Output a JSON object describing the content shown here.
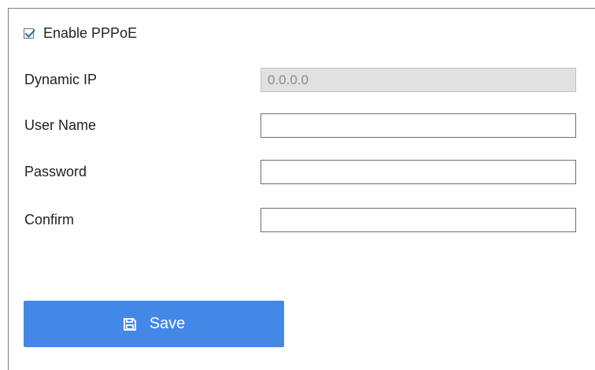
{
  "pppoe": {
    "enable_label": "Enable PPPoE",
    "enable_checked": true
  },
  "fields": {
    "dynamic_ip": {
      "label": "Dynamic IP",
      "value": "0.0.0.0"
    },
    "user_name": {
      "label": "User Name",
      "value": ""
    },
    "password": {
      "label": "Password",
      "value": ""
    },
    "confirm": {
      "label": "Confirm",
      "value": ""
    }
  },
  "actions": {
    "save_label": "Save",
    "save_icon": "save-icon"
  },
  "colors": {
    "accent": "#4388e6",
    "checkbox_check": "#1f78d1",
    "disabled_field": "#e1e1e1"
  }
}
